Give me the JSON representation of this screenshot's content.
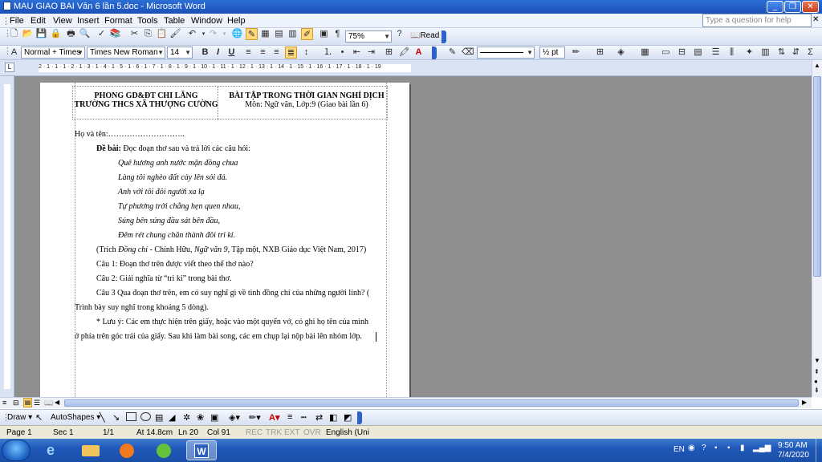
{
  "window": {
    "title": "MAU GIAO BAI Văn 6 lần 5.doc - Microsoft Word"
  },
  "menu": [
    "File",
    "Edit",
    "View",
    "Insert",
    "Format",
    "Tools",
    "Table",
    "Window",
    "Help"
  ],
  "help_search": {
    "placeholder": "Type a question for help"
  },
  "toolbar": {
    "zoom": "75%",
    "read_label": "Read",
    "style": "Normal + Times",
    "font": "Times New Roman",
    "size": "14",
    "line_weight": "½ pt"
  },
  "ruler": {
    "marks": "2 · 1 · 1 · 1 · 2 · 1 · 3 · 1 · 4 · 1 · 5 · 1 · 6 · 1 · 7 · 1 · 8 · 1 · 9 · 1 · 10 · 1 · 11 · 1 · 12 · 1 · 13 · 1 · 14 · 1 · 15 · 1 · 16 · 1 · 17 · 1 · 18 · 1 · 19"
  },
  "document": {
    "header_left_1": "PHONG GD&ĐT CHI LĂNG",
    "header_left_2": "TRƯỜNG THCS XÃ THƯỢNG CƯỜNG",
    "header_right_1": "BÀI TẬP TRONG THỜI GIAN NGHỈ DỊCH",
    "header_right_2": "Môn: Ngữ văn, Lớp:9 (Giao bài lần 6)",
    "name_line": "Họ và tên:………………………..",
    "task_label": "Đề bài:",
    "task_text": " Đọc đoạn thơ sau và trả lời các câu hỏi:",
    "poem": [
      "Quê hương anh nước mặn đồng chua",
      "Làng tôi nghèo đất cày lên sỏi đá.",
      "Anh với tôi đôi người xa lạ",
      "Tự phương trời chẳng hẹn quen nhau,",
      "Súng bên súng đầu sát bên đầu,",
      "Đêm rét chung chăn thành đôi tri kỉ."
    ],
    "source_pre": "(Trích ",
    "source_title": "Đồng chí",
    "source_mid": " - Chính Hữu, ",
    "source_book": "Ngữ văn 9",
    "source_post": ", Tập một, NXB Giáo dục Việt Nam, 2017)",
    "q1": "Câu 1: Đoạn thơ trên được viết theo thể thơ nào?",
    "q2": "Câu 2: Giải nghĩa từ “tri kỉ” trong bài thơ.",
    "q3_a": "Câu 3 Qua đoạn thơ trên, em có suy nghĩ gì về tình đồng chí của những người lính? (",
    "q3_b": "Trình bày suy nghĩ trong khoảng 5 dòng).",
    "note_a": "* Lưu ý: Các em thực hiện trên giấy, hoặc vào một quyển vở, có ghi họ tên của mình",
    "note_b": "ở phía trên góc trái của giấy. Sau khi làm bài song, các em chụp lại nộp bài lên nhóm lớp."
  },
  "drawbar": {
    "draw_label": "Draw",
    "autoshapes_label": "AutoShapes"
  },
  "status": {
    "page": "Page 1",
    "sec": "Sec 1",
    "pages": "1/1",
    "at": "At 14.8cm",
    "ln": "Ln 20",
    "col": "Col 91",
    "rec": "REC",
    "trk": "TRK",
    "ext": "EXT",
    "ovr": "OVR",
    "lang": "English (Uni"
  },
  "tray": {
    "lang": "EN",
    "time": "9:50 AM",
    "date": "7/4/2020"
  }
}
